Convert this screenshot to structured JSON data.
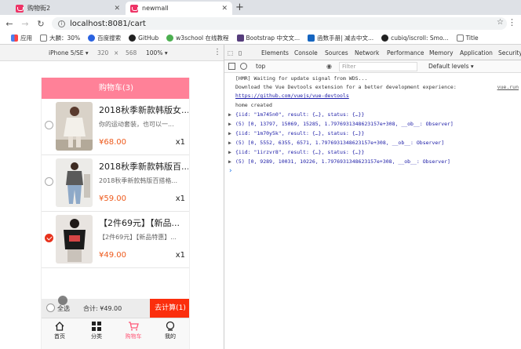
{
  "browser": {
    "tabs": [
      {
        "title": "购物街2",
        "active": false
      },
      {
        "title": "newmall",
        "active": true
      }
    ],
    "new_tab_icon": "+",
    "url": {
      "host": "localhost",
      "rest": ":8081/cart"
    },
    "bookmarks": [
      {
        "label": "应用",
        "icon": "apps-grid-icon"
      },
      {
        "label": "大麟：30%",
        "icon": "doc-icon"
      },
      {
        "label": "百度搜索",
        "icon": "baidu-paw-icon"
      },
      {
        "label": "GitHub",
        "icon": "github-icon"
      },
      {
        "label": "w3school 在线教程",
        "icon": "w3school-icon"
      },
      {
        "label": "Bootstrap 中文文...",
        "icon": "bootstrap-icon"
      },
      {
        "label": "函数手册| 减去中文...",
        "icon": "api-icon"
      },
      {
        "label": "cubiq/iscroll: Smo...",
        "icon": "github-icon"
      },
      {
        "label": "Title",
        "icon": "doc-icon"
      }
    ]
  },
  "device_toolbar": {
    "device": "iPhone 5/SE ▾",
    "width": "320",
    "times": "×",
    "height": "568",
    "zoom": "100% ▾"
  },
  "cart": {
    "nav_title": "购物车(3)",
    "items": [
      {
        "title": "2018秋季新款韩版女...",
        "desc": "你的运动套装，也可以一...",
        "price": "¥68.00",
        "qty": "x1",
        "checked": false
      },
      {
        "title": "2018秋季新款韩版百...",
        "desc": "2018秋季新款韩版百搭格...",
        "price": "¥59.00",
        "qty": "x1",
        "checked": false
      },
      {
        "title": "【2件69元】【新品...",
        "desc": "【2件69元】【新品特惠】...",
        "price": "¥49.00",
        "qty": "x1",
        "checked": true
      }
    ],
    "select_all": "全选",
    "total": "合计: ¥49.00",
    "checkout": "去计算(1)"
  },
  "tabbar": [
    {
      "label": "首页",
      "icon": "home-icon",
      "active": false
    },
    {
      "label": "分类",
      "icon": "category-grid-icon",
      "active": false
    },
    {
      "label": "购物车",
      "icon": "cart-icon",
      "active": true
    },
    {
      "label": "我的",
      "icon": "profile-icon",
      "active": false
    }
  ],
  "devtools": {
    "tabs": [
      "Elements",
      "Console",
      "Sources",
      "Network",
      "Performance",
      "Memory",
      "Application",
      "Security"
    ],
    "active_tab": "Console",
    "context": "top",
    "filter_placeholder": "Filter",
    "levels": "Default levels ▾",
    "lines": [
      {
        "text": "[HMR] Waiting for update signal from WDS...",
        "type": "log"
      },
      {
        "text": "Download the Vue Devtools extension for a better development experience:",
        "type": "log",
        "src": "vue.run"
      },
      {
        "text": "https://github.com/vuejs/vue-devtools",
        "type": "link"
      },
      {
        "text": "home created",
        "type": "log"
      },
      {
        "text": "{iid: \"1m745n0\", result: {…}, status: {…}}",
        "type": "obj"
      },
      {
        "text": "(5) [0, 13797, 15069, 15285, 1.7976931348623157e+308, __ob__: Observer]",
        "type": "obj"
      },
      {
        "text": "{iid: \"1m70y5k\", result: {…}, status: {…}}",
        "type": "obj"
      },
      {
        "text": "(5) [0, 5552, 6355, 6571, 1.7976931348623157e+308, __ob__: Observer]",
        "type": "obj"
      },
      {
        "text": "{iid: \"1irzvr8\", result: {…}, status: {…}}",
        "type": "obj"
      },
      {
        "text": "(5) [0, 9289, 10031, 10226, 1.7976931348623157e+308, __ob__: Observer]",
        "type": "obj"
      }
    ],
    "prompt": "›"
  },
  "colors": {
    "nav_pink": "#ff8198",
    "price_orange": "#ee5a1c",
    "checkout_red": "#fb2e0d",
    "tab_active": "#ff5777"
  }
}
